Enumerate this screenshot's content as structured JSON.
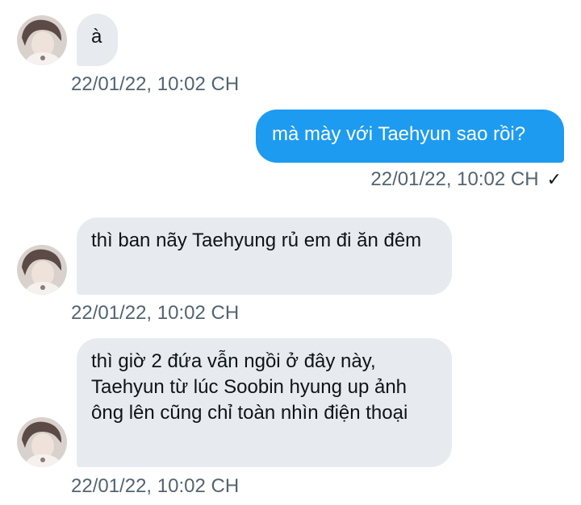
{
  "messages": [
    {
      "direction": "incoming",
      "text": "à",
      "time": "22/01/22, 10:02 CH"
    },
    {
      "direction": "outgoing",
      "text": "mà mày với Taehyun sao rồi?",
      "time": "22/01/22, 10:02 CH",
      "status_icon": "check-icon"
    },
    {
      "direction": "incoming",
      "text": "thì ban nãy Taehyung rủ em đi ăn đêm",
      "time": "22/01/22, 10:02 CH"
    },
    {
      "direction": "incoming",
      "text": "thì giờ 2 đứa vẫn ngồi ở đây này, Taehyun từ lúc Soobin hyung up ảnh ông lên cũng chỉ toàn nhìn điện thoại",
      "time": "22/01/22, 10:02 CH"
    }
  ],
  "colors": {
    "incoming_bubble": "#e7ebef",
    "outgoing_bubble": "#1d9bf0",
    "timestamp": "#536471",
    "text": "#0f1419"
  }
}
